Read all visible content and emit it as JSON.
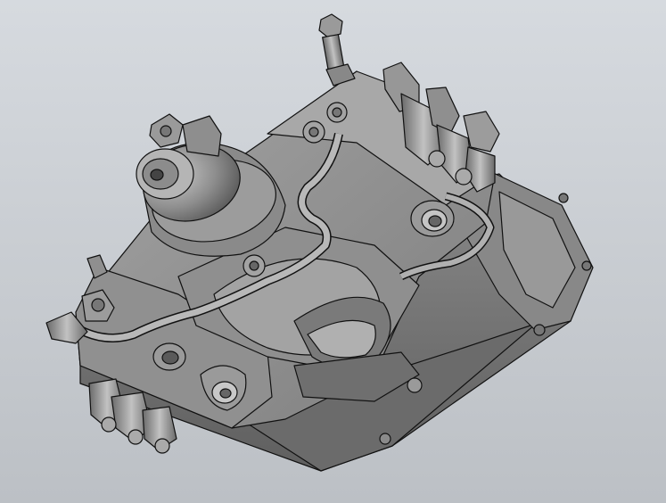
{
  "viewport": {
    "background_top": "#d6dadf",
    "background_bottom": "#bcc0c5"
  },
  "model": {
    "description_icon": "cad-3d-model",
    "shade_light": "#9a9a9a",
    "shade_mid": "#7d7d7d",
    "shade_dark": "#5a5a5a",
    "edge_color": "#111111"
  }
}
